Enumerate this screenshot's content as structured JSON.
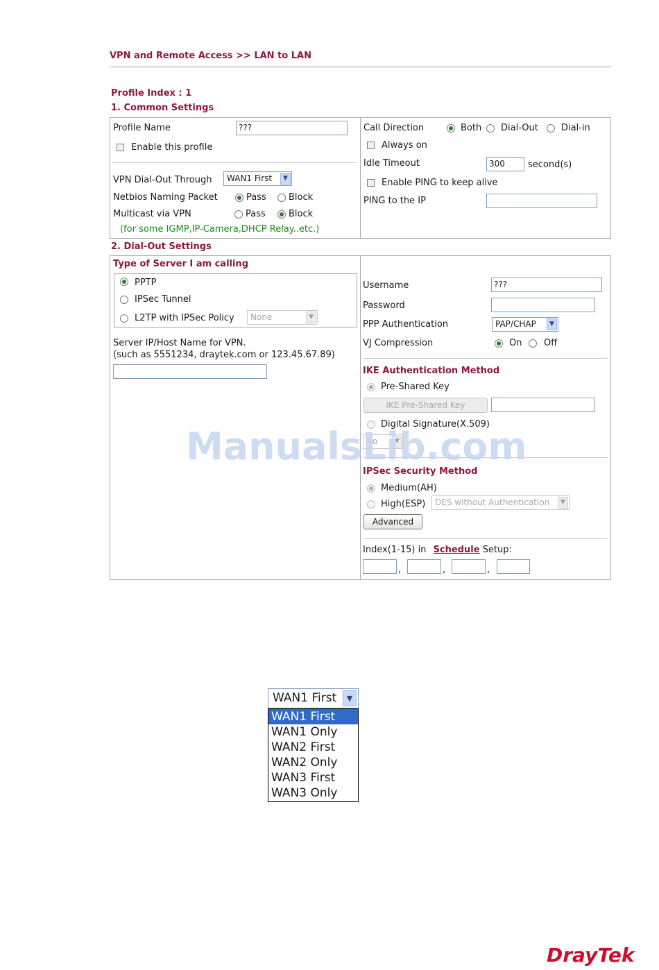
{
  "breadcrumb": "VPN and Remote Access >> LAN to LAN",
  "profile_index": "Profile Index : 1",
  "common": {
    "title": "1. Common Settings",
    "profile_name_label": "Profile Name",
    "profile_name_value": "???",
    "enable_profile_label": "Enable this profile",
    "dialout_through_label": "VPN Dial-Out Through",
    "dialout_through_value": "WAN1 First",
    "netbios_label": "Netbios Naming Packet",
    "multicast_label": "Multicast via VPN",
    "pass_label": "Pass",
    "block_label": "Block",
    "multicast_note": "(for some IGMP,IP-Camera,DHCP Relay..etc.)",
    "call_direction_label": "Call Direction",
    "both_label": "Both",
    "dialout_label": "Dial-Out",
    "dialin_label": "Dial-in",
    "always_on_label": "Always on",
    "idle_timeout_label": "Idle Timeout",
    "idle_timeout_value": "300",
    "idle_timeout_unit": "second(s)",
    "ping_keepalive_label": "Enable PING to keep alive",
    "ping_ip_label": "PING to the IP",
    "ping_ip_value": ""
  },
  "dialout": {
    "title": "2. Dial-Out Settings",
    "server_type_title": "Type of Server I am calling",
    "pptp_label": "PPTP",
    "ipsec_tunnel_label": "IPSec Tunnel",
    "l2tp_label": "L2TP with IPSec Policy",
    "l2tp_policy_value": "None",
    "server_ip_label": "Server IP/Host Name for VPN.",
    "server_ip_hint": "(such as 5551234, draytek.com or 123.45.67.89)",
    "server_ip_value": "",
    "username_label": "Username",
    "username_value": "???",
    "password_label": "Password",
    "password_value": "",
    "ppp_auth_label": "PPP Authentication",
    "ppp_auth_value": "PAP/CHAP",
    "vj_label": "VJ Compression",
    "on_label": "On",
    "off_label": "Off",
    "ike_title": "IKE Authentication Method",
    "preshared_label": "Pre-Shared Key",
    "ike_key_button": "IKE Pre-Shared Key",
    "ike_key_value": "",
    "digital_sig_label": "Digital Signature(X.509)",
    "digital_sig_value": "No",
    "ipsec_title": "IPSec Security Method",
    "medium_label": "Medium(AH)",
    "high_label": "High(ESP)",
    "high_value": "DES without Authentication",
    "advanced_button": "Advanced",
    "schedule_prefix": "Index(1-15) in",
    "schedule_link": "Schedule",
    "schedule_suffix": "Setup:",
    "schedule_sep": ","
  },
  "watermark": "ManualsLib.com",
  "dropdown": {
    "selected": "WAN1 First",
    "options": [
      "WAN1 First",
      "WAN1 Only",
      "WAN2 First",
      "WAN2 Only",
      "WAN3 First",
      "WAN3 Only"
    ]
  },
  "brand": "DrayTek"
}
